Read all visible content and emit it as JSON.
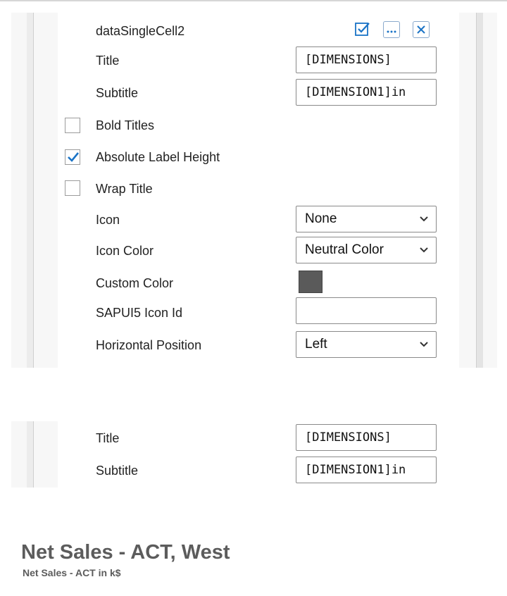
{
  "panel1": {
    "component_name": "dataSingleCell2",
    "title_label": "Title",
    "title_value": "[DIMENSIONS]",
    "subtitle_label": "Subtitle",
    "subtitle_value": "[DIMENSION1]in",
    "bold_titles_label": "Bold Titles",
    "bold_titles_checked": false,
    "absolute_label_height_label": "Absolute Label Height",
    "absolute_label_height_checked": true,
    "wrap_title_label": "Wrap Title",
    "wrap_title_checked": false,
    "icon_label": "Icon",
    "icon_value": "None",
    "icon_color_label": "Icon Color",
    "icon_color_value": "Neutral Color",
    "custom_color_label": "Custom Color",
    "custom_color_value": "#5a5a5a",
    "sapui5_icon_label": "SAPUI5 Icon Id",
    "sapui5_icon_value": "",
    "horizontal_position_label": "Horizontal Position",
    "horizontal_position_value": "Left",
    "toolbar_icons": [
      "apply-check-icon",
      "more-options-icon",
      "close-icon"
    ]
  },
  "panel2": {
    "title_label": "Title",
    "title_value": "[DIMENSIONS]",
    "subtitle_label": "Subtitle",
    "subtitle_value": "[DIMENSION1]in"
  },
  "preview": {
    "title": "Net Sales - ACT, West",
    "subtitle": "Net Sales - ACT in k$"
  },
  "colors": {
    "accent_blue": "#1a73c6",
    "preview_text": "#5c5c5c"
  }
}
